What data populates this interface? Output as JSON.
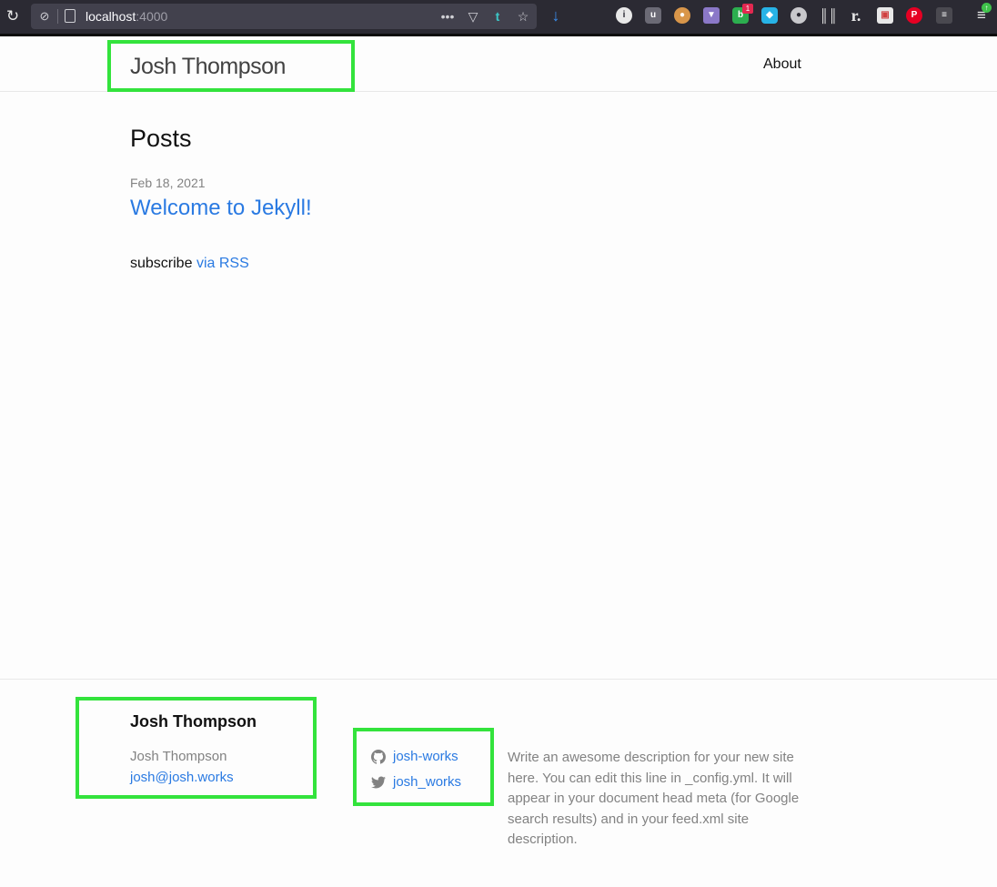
{
  "browser": {
    "url_host": "localhost",
    "url_port": ":4000",
    "notification_badge": "1"
  },
  "header": {
    "site_title": "Josh Thompson",
    "nav": [
      {
        "label": "About"
      }
    ]
  },
  "main": {
    "heading": "Posts",
    "posts": [
      {
        "date": "Feb 18, 2021",
        "title": "Welcome to Jekyll!"
      }
    ],
    "rss_prefix": "subscribe",
    "rss_link": "via RSS"
  },
  "footer": {
    "heading": "Josh Thompson",
    "name": "Josh Thompson",
    "email": "josh@josh.works",
    "social": [
      {
        "icon": "github-icon",
        "label": "josh-works"
      },
      {
        "icon": "twitter-icon",
        "label": "josh_works"
      }
    ],
    "description": "Write an awesome description for your new site here. You can edit this line in _config.yml. It will appear in your document head meta (for Google search results) and in your feed.xml site description."
  },
  "colors": {
    "link": "#2a7ae2",
    "muted": "#828282",
    "highlight": "#33e33c"
  }
}
